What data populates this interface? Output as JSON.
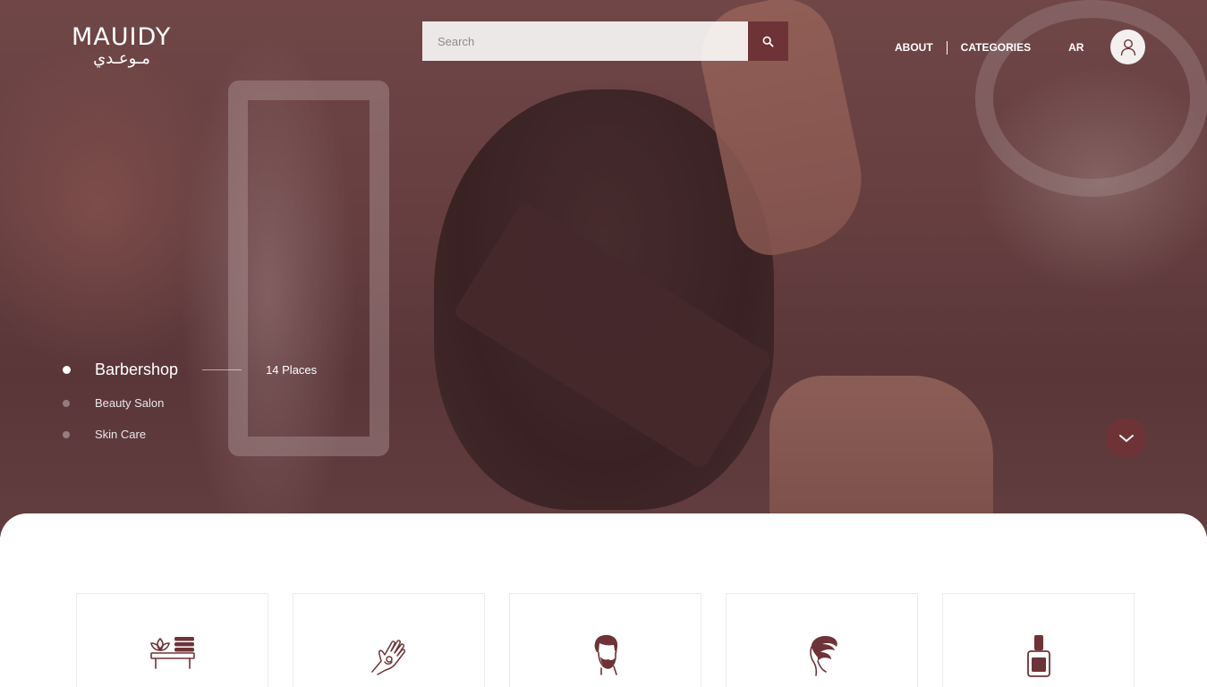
{
  "brand": {
    "name_en": "MAUIDY",
    "name_ar": "مـوعـدي"
  },
  "search": {
    "placeholder": "Search",
    "icon": "search-icon"
  },
  "nav": {
    "about": "ABOUT",
    "categories": "CATEGORIES",
    "language": "AR",
    "account_icon": "user-icon"
  },
  "slider": {
    "items": [
      {
        "label": "Barbershop",
        "count": "14 Places",
        "active": true
      },
      {
        "label": "Beauty Salon",
        "active": false
      },
      {
        "label": "Skin Care",
        "active": false
      }
    ],
    "scroll_icon": "chevron-down-icon"
  },
  "category_cards": [
    {
      "icon": "spa-icon"
    },
    {
      "icon": "henna-hand-icon"
    },
    {
      "icon": "beard-man-icon"
    },
    {
      "icon": "hair-woman-icon"
    },
    {
      "icon": "nail-polish-icon"
    }
  ],
  "colors": {
    "accent": "#6e3337",
    "icon": "#6e3337",
    "text_on_dark": "#ffffff"
  }
}
